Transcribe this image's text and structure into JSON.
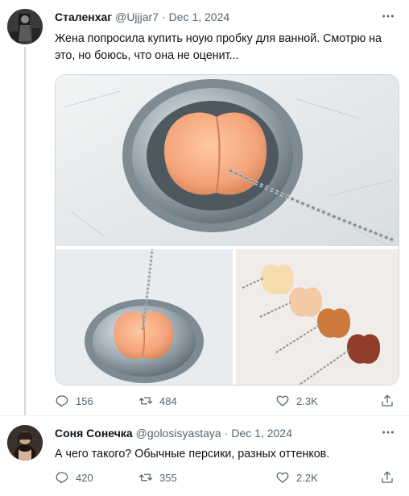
{
  "tweets": [
    {
      "author_name": "Сталенхаг",
      "handle": "@Ujjjar7",
      "date": "Dec 1, 2024",
      "text": "Жена попросила купить ноую пробку для ванной. Смотрю на это, но боюсь, что она не оценит...",
      "stats": {
        "replies": "156",
        "retweets": "484",
        "likes": "2.3K"
      }
    },
    {
      "author_name": "Соня Сонечка",
      "handle": "@golosisyastaya",
      "date": "Dec 1, 2024",
      "text": "А чего такого? Обычные персики, разных оттенков.",
      "stats": {
        "replies": "420",
        "retweets": "355",
        "likes": "2.2K"
      }
    }
  ],
  "separator": "·",
  "icons": {
    "more": "more-horizontal-icon",
    "reply": "reply-icon",
    "retweet": "retweet-icon",
    "like": "heart-icon",
    "share": "share-icon"
  },
  "colors": {
    "text": "#0f1419",
    "secondary": "#536471",
    "border": "#cfd9de",
    "thread_line": "#cfd9de"
  }
}
